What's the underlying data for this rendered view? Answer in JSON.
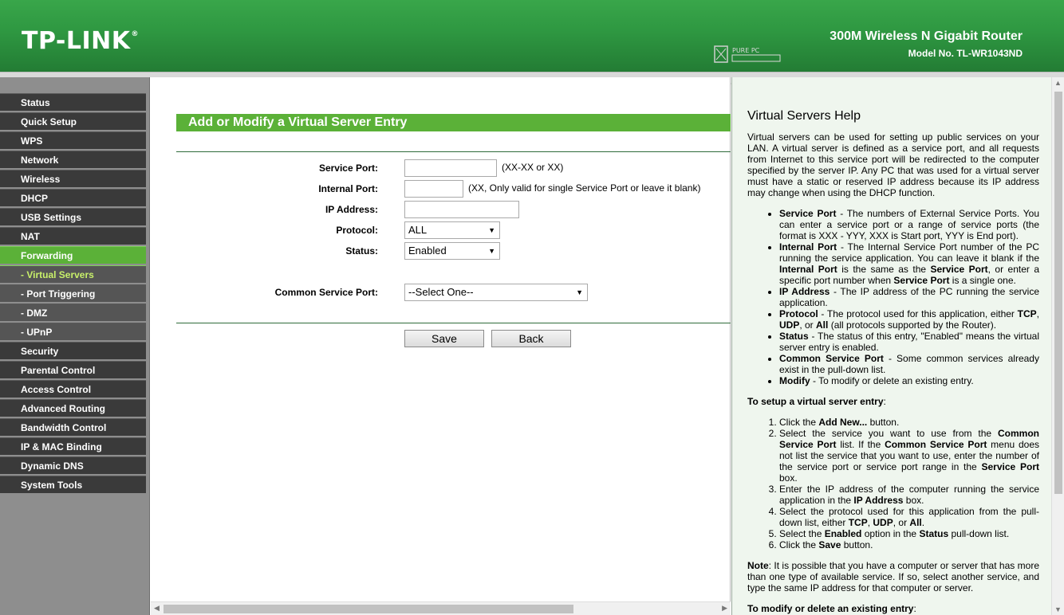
{
  "header": {
    "logo": "TP-LINK",
    "logo_mark": "®",
    "product_name": "300M Wireless N Gigabit Router",
    "model_no": "Model No. TL-WR1043ND",
    "watermark": "PURE PC"
  },
  "sidebar": {
    "items": [
      {
        "label": "Status"
      },
      {
        "label": "Quick Setup"
      },
      {
        "label": "WPS"
      },
      {
        "label": "Network"
      },
      {
        "label": "Wireless"
      },
      {
        "label": "DHCP"
      },
      {
        "label": "USB Settings"
      },
      {
        "label": "NAT"
      },
      {
        "label": "Forwarding"
      },
      {
        "label": "- Virtual Servers"
      },
      {
        "label": "- Port Triggering"
      },
      {
        "label": "- DMZ"
      },
      {
        "label": "- UPnP"
      },
      {
        "label": "Security"
      },
      {
        "label": "Parental Control"
      },
      {
        "label": "Access Control"
      },
      {
        "label": "Advanced Routing"
      },
      {
        "label": "Bandwidth Control"
      },
      {
        "label": "IP & MAC Binding"
      },
      {
        "label": "Dynamic DNS"
      },
      {
        "label": "System Tools"
      }
    ]
  },
  "main": {
    "title": "Add or Modify a Virtual Server Entry",
    "service_port": {
      "label": "Service Port:",
      "value": "",
      "hint": "(XX-XX or XX)"
    },
    "internal_port": {
      "label": "Internal Port:",
      "value": "",
      "hint": "(XX, Only valid for single Service Port or leave it blank)"
    },
    "ip_address": {
      "label": "IP Address:",
      "value": ""
    },
    "protocol": {
      "label": "Protocol:",
      "value": "ALL"
    },
    "status": {
      "label": "Status:",
      "value": "Enabled"
    },
    "common_service_port": {
      "label": "Common Service Port:",
      "value": "--Select One--"
    },
    "save_label": "Save",
    "back_label": "Back"
  },
  "help": {
    "title": "Virtual Servers Help",
    "intro": "Virtual servers can be used for setting up public services on your LAN. A virtual server is defined as a service port, and all requests from Internet to this service port will be redirected to the computer specified by the server IP. Any PC that was used for a virtual server must have a static or reserved IP address because its IP address may change when using the DHCP function.",
    "b1_term": "Service Port",
    "b1_text": " - The numbers of External Service Ports. You can enter a service port or a range of service ports (the format is XXX - YYY, XXX is Start port, YYY is End port).",
    "b2_term": "Internal Port",
    "b2_text1": " - The Internal Service Port number of the PC running the service application. You can leave it blank if the ",
    "b2_term2": "Internal Port",
    "b2_text2": " is the same as the ",
    "b2_term3": "Service Port",
    "b2_text3": ", or enter a specific port number when ",
    "b2_term4": "Service Port",
    "b2_text4": " is a single one.",
    "b3_term": "IP Address",
    "b3_text": " - The IP address of the PC running the service application.",
    "b4_term": "Protocol",
    "b4_text1": " - The protocol used for this application, either ",
    "b4_tcp": "TCP",
    "b4_sep1": ", ",
    "b4_udp": "UDP",
    "b4_sep2": ", or ",
    "b4_all": "All",
    "b4_text2": " (all protocols supported by the Router).",
    "b5_term": "Status",
    "b5_text": " - The status of this entry, \"Enabled\" means the virtual server entry is enabled.",
    "b6_term": "Common Service Port",
    "b6_text": " - Some common services already exist in the pull-down list.",
    "b7_term": "Modify",
    "b7_text": " - To modify or delete an existing entry.",
    "setup_heading": "To setup a virtual server entry",
    "setup_colon": ":",
    "s1_a": "Click the ",
    "s1_b": "Add New...",
    "s1_c": " button.",
    "s2_a": "Select the service you want to use from the ",
    "s2_b": "Common Service Port",
    "s2_c": " list. If the ",
    "s2_d": "Common Service Port",
    "s2_e": " menu does not list the service that you want to use, enter the number of the service port or service port range in the ",
    "s2_f": "Service Port",
    "s2_g": " box.",
    "s3_a": "Enter the IP address of the computer running the service application in the ",
    "s3_b": "IP Address",
    "s3_c": " box.",
    "s4_a": "Select the protocol used for this application from the pull-down list, either ",
    "s4_b": "TCP",
    "s4_c": ", ",
    "s4_d": "UDP",
    "s4_e": ", or ",
    "s4_f": "All",
    "s4_g": ".",
    "s5_a": "Select the ",
    "s5_b": "Enabled",
    "s5_c": " option in the ",
    "s5_d": "Status",
    "s5_e": " pull-down list.",
    "s6_a": "Click the ",
    "s6_b": "Save",
    "s6_c": " button.",
    "note_term": "Note",
    "note_text": ": It is possible that you have a computer or server that has more than one type of available service. If so, select another service, and type the same IP address for that computer or server.",
    "modify_heading": "To modify or delete an existing entry",
    "modify_colon": ":"
  },
  "colors": {
    "header_green": "#2e9741",
    "accent_green": "#5bb138",
    "sidebar_dark": "#3a3a3a",
    "active_sub_text": "#c8f06a",
    "help_bg": "#eff6ee"
  }
}
